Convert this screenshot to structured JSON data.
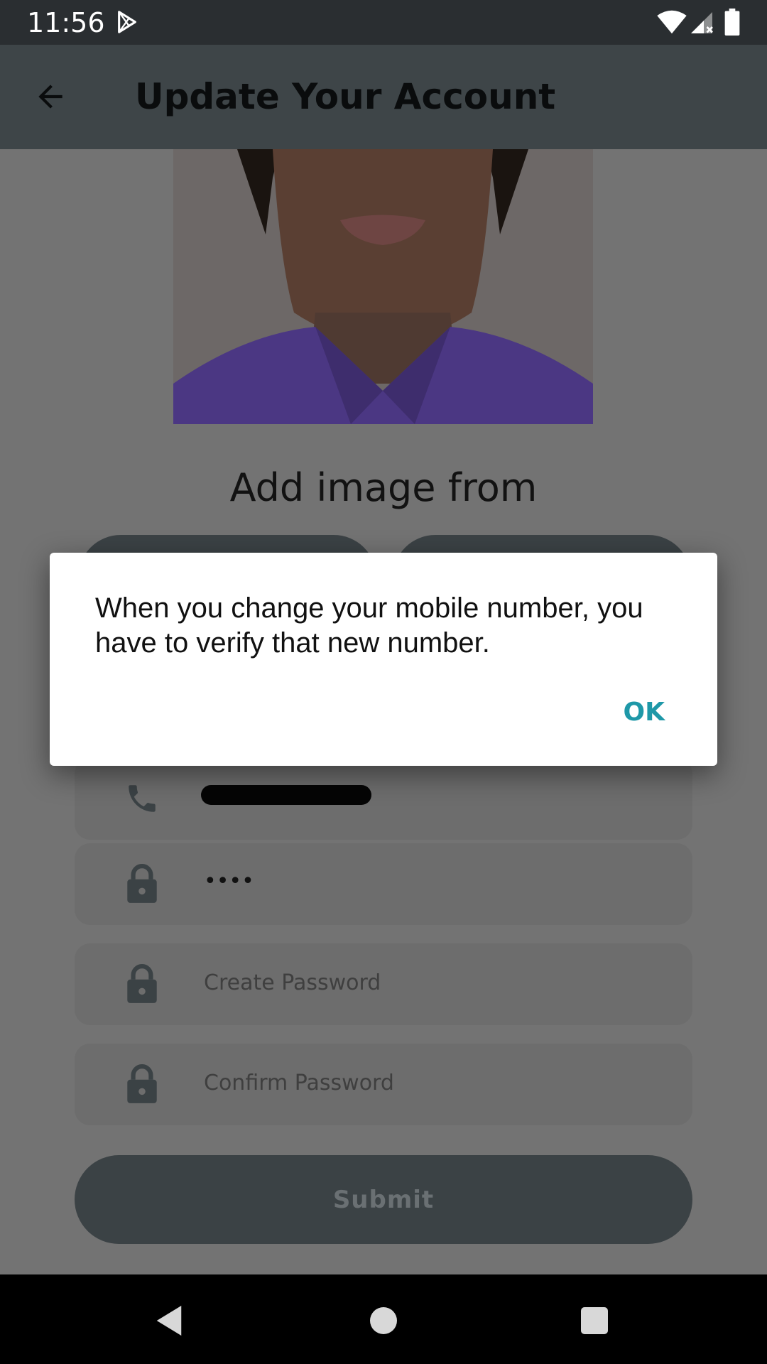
{
  "status_bar": {
    "time": "11:56",
    "icons": [
      "play-store-icon",
      "wifi-icon",
      "signal-icon",
      "battery-icon"
    ]
  },
  "app_bar": {
    "title": "Update Your Account",
    "back_icon": "arrow-back-icon"
  },
  "main": {
    "add_image_title": "Add image from",
    "fields": {
      "phone": {
        "icon": "phone-icon",
        "value": ""
      },
      "current_password": {
        "icon": "lock-icon",
        "value": "••••"
      },
      "create_password": {
        "icon": "lock-icon",
        "placeholder": "Create Password"
      },
      "confirm_password": {
        "icon": "lock-icon",
        "placeholder": "Confirm Password"
      }
    },
    "submit_label": "Submit"
  },
  "dialog": {
    "message": "When you change your mobile number, you have to verify that new number.",
    "ok_label": "OK"
  },
  "colors": {
    "accent": "#1e98a8",
    "app_bar": "#3e4548",
    "button": "#3b4245"
  }
}
